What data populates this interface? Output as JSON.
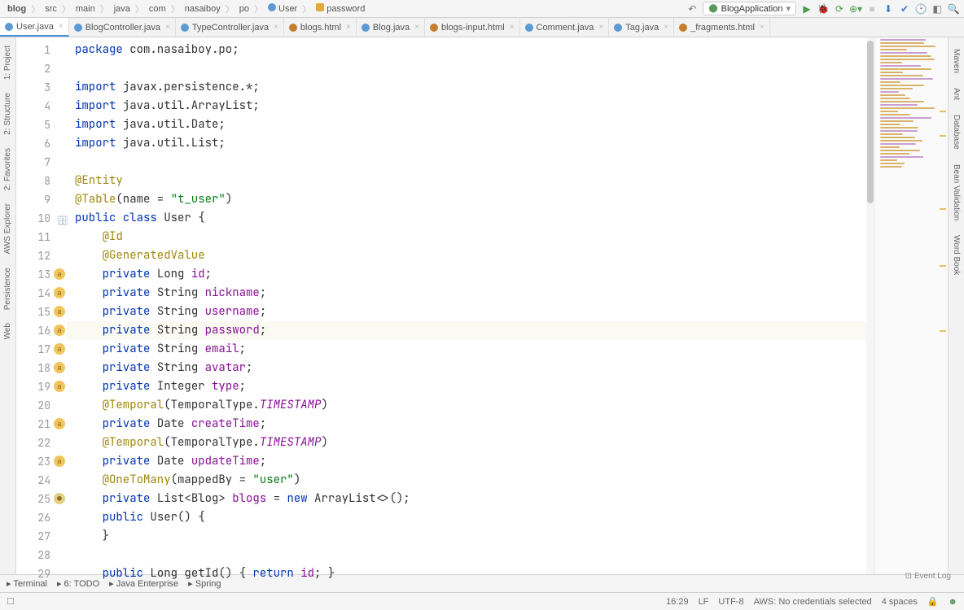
{
  "breadcrumb": [
    "blog",
    "src",
    "main",
    "java",
    "com",
    "nasaiboy",
    "po",
    "User",
    "password"
  ],
  "breadcrumb_icons": [
    "",
    "",
    "",
    "",
    "",
    "",
    "",
    "c",
    "f"
  ],
  "run_config": "BlogApplication",
  "tabs": [
    {
      "label": "User.java",
      "icon": "c",
      "active": true
    },
    {
      "label": "BlogController.java",
      "icon": "c"
    },
    {
      "label": "TypeController.java",
      "icon": "c"
    },
    {
      "label": "blogs.html",
      "icon": "h"
    },
    {
      "label": "Blog.java",
      "icon": "c"
    },
    {
      "label": "blogs-input.html",
      "icon": "h"
    },
    {
      "label": "Comment.java",
      "icon": "c"
    },
    {
      "label": "Tag.java",
      "icon": "c"
    },
    {
      "label": "_fragments.html",
      "icon": "h"
    }
  ],
  "left_tool_tabs": [
    "1: Project",
    "2: Structure",
    "2: Favorites",
    "AWS Explorer",
    "Persistence",
    "Web"
  ],
  "right_tool_tabs": [
    "Maven",
    "Ant",
    "Database",
    "Bean Validation",
    "Word Book"
  ],
  "code": {
    "lines": [
      {
        "n": 1,
        "type": "pkg",
        "text": "package com.nasaiboy.po;"
      },
      {
        "n": 2,
        "type": "blank"
      },
      {
        "n": 3,
        "type": "imp",
        "text": "import javax.persistence.*;"
      },
      {
        "n": 4,
        "type": "imp",
        "text": "import java.util.ArrayList;"
      },
      {
        "n": 5,
        "type": "imp",
        "text": "import java.util.Date;"
      },
      {
        "n": 6,
        "type": "imp",
        "text": "import java.util.List;"
      },
      {
        "n": 7,
        "type": "blank"
      },
      {
        "n": 8,
        "type": "ann",
        "text": "@Entity"
      },
      {
        "n": 9,
        "type": "ann2",
        "ann": "@Table",
        "args": "(name = ",
        "str": "\"t_user\"",
        "tail": ")"
      },
      {
        "n": 10,
        "type": "classdecl",
        "marker": "db"
      },
      {
        "n": 11,
        "type": "ann-ind",
        "text": "@Id"
      },
      {
        "n": 12,
        "type": "ann-ind",
        "text": "@GeneratedValue"
      },
      {
        "n": 13,
        "type": "field",
        "ftype": "Long",
        "name": "id",
        "marker": "a"
      },
      {
        "n": 14,
        "type": "field",
        "ftype": "String",
        "name": "nickname",
        "marker": "a"
      },
      {
        "n": 15,
        "type": "field",
        "ftype": "String",
        "name": "username",
        "marker": "a"
      },
      {
        "n": 16,
        "type": "field",
        "ftype": "String",
        "name": "password",
        "marker": "a",
        "hl": true
      },
      {
        "n": 17,
        "type": "field",
        "ftype": "String",
        "name": "email",
        "marker": "a"
      },
      {
        "n": 18,
        "type": "field",
        "ftype": "String",
        "name": "avatar",
        "marker": "a"
      },
      {
        "n": 19,
        "type": "field",
        "ftype": "Integer",
        "name": "type",
        "marker": "a"
      },
      {
        "n": 20,
        "type": "temporal"
      },
      {
        "n": 21,
        "type": "field",
        "ftype": "Date",
        "name": "createTime",
        "marker": "a"
      },
      {
        "n": 22,
        "type": "temporal"
      },
      {
        "n": 23,
        "type": "field",
        "ftype": "Date",
        "name": "updateTime",
        "marker": "a"
      },
      {
        "n": 24,
        "type": "onetomany",
        "str": "\"user\""
      },
      {
        "n": 25,
        "type": "listblogs",
        "marker": "p"
      },
      {
        "n": 26,
        "type": "ctor"
      },
      {
        "n": 27,
        "type": "close-brace"
      },
      {
        "n": 28,
        "type": "blank"
      },
      {
        "n": 29,
        "type": "getid"
      }
    ]
  },
  "bottom_tools": [
    "Terminal",
    "6: TODO",
    "Java Enterprise",
    "Spring"
  ],
  "event_log": "Event Log",
  "status": {
    "cursor": "16:29",
    "lf": "LF",
    "enc": "UTF-8",
    "aws": "AWS: No credentials selected",
    "spaces": "4 spaces"
  }
}
